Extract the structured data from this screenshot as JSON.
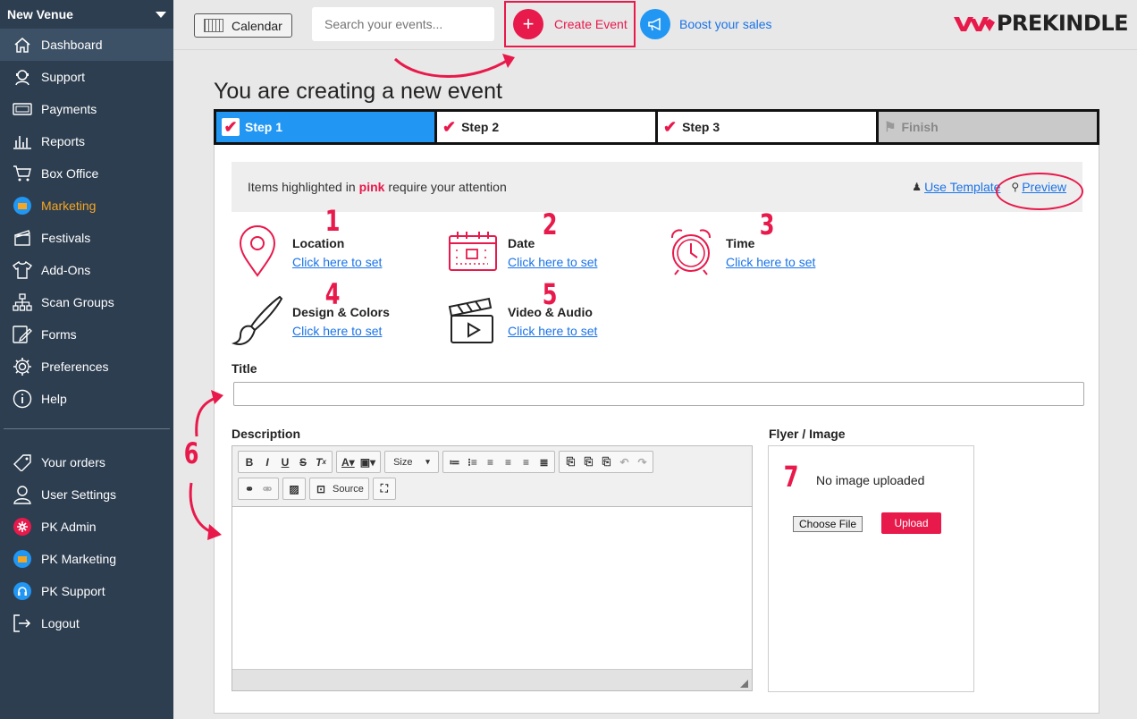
{
  "sidebar": {
    "venue": "New Venue",
    "items": [
      {
        "label": "Dashboard"
      },
      {
        "label": "Support"
      },
      {
        "label": "Payments"
      },
      {
        "label": "Reports"
      },
      {
        "label": "Box Office"
      },
      {
        "label": "Marketing"
      },
      {
        "label": "Festivals"
      },
      {
        "label": "Add-Ons"
      },
      {
        "label": "Scan Groups"
      },
      {
        "label": "Forms"
      },
      {
        "label": "Preferences"
      },
      {
        "label": "Help"
      }
    ],
    "bottom": [
      {
        "label": "Your orders"
      },
      {
        "label": "User Settings"
      },
      {
        "label": "PK Admin"
      },
      {
        "label": "PK Marketing"
      },
      {
        "label": "PK Support"
      },
      {
        "label": "Logout"
      }
    ]
  },
  "topbar": {
    "calendar_label": "Calendar",
    "search_placeholder": "Search your events...",
    "create_label": "Create Event",
    "boost_label": "Boost your sales",
    "logo": "PREKINDLE"
  },
  "main": {
    "title": "You are creating a new event",
    "steps": [
      "Step 1",
      "Step 2",
      "Step 3",
      "Finish"
    ],
    "notice_pre": "Items highlighted in",
    "notice_pink": "pink",
    "notice_post": "require your attention",
    "use_template": "Use Template",
    "preview": "Preview",
    "options": [
      {
        "num": "1",
        "title": "Location",
        "link": "Click here to set"
      },
      {
        "num": "2",
        "title": "Date",
        "link": "Click here to set"
      },
      {
        "num": "3",
        "title": "Time",
        "link": "Click here to set"
      },
      {
        "num": "4",
        "title": "Design & Colors",
        "link": "Click here to set"
      },
      {
        "num": "5",
        "title": "Video & Audio",
        "link": "Click here to set"
      }
    ],
    "title_label": "Title",
    "description_label": "Description",
    "description_num": "6",
    "flyer_label": "Flyer / Image",
    "flyer_num": "7",
    "no_image": "No image uploaded",
    "choose_file": "Choose File",
    "upload": "Upload",
    "editor": {
      "size_label": "Size",
      "source_label": "Source"
    }
  },
  "colors": {
    "sidebar_bg": "#2d3e50",
    "accent_pink": "#e8194b",
    "accent_blue": "#2196f3",
    "marketing_orange": "#f5a623"
  }
}
